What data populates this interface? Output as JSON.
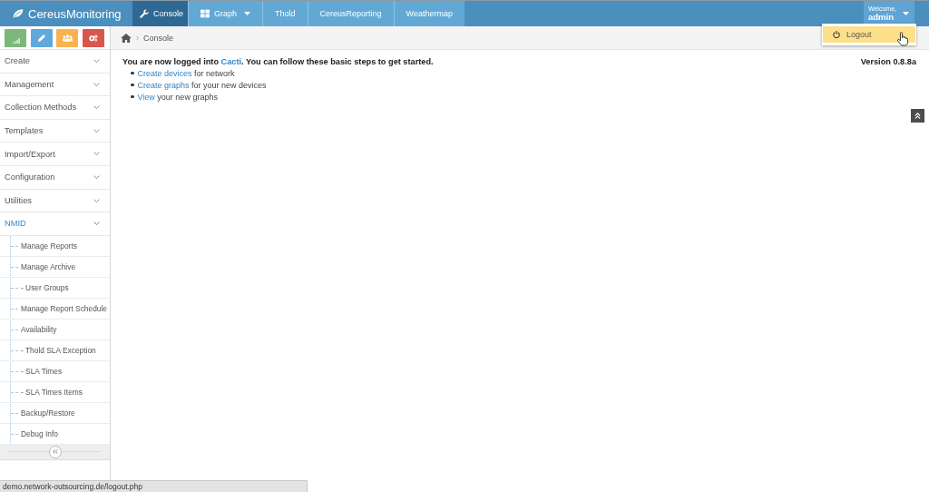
{
  "header": {
    "brand": "CereusMonitoring",
    "tabs": [
      {
        "label": "Console",
        "selected": true,
        "has_menu": false
      },
      {
        "label": "Graph",
        "selected": false,
        "has_menu": true
      },
      {
        "label": "Thold",
        "selected": false,
        "has_menu": false
      },
      {
        "label": "CereusReporting",
        "selected": false,
        "has_menu": false
      },
      {
        "label": "Weathermap",
        "selected": false,
        "has_menu": false
      }
    ],
    "user": {
      "greeting": "Welcome,",
      "name": "admin"
    }
  },
  "user_menu": {
    "items": [
      {
        "label": "Logout",
        "highlighted": true
      }
    ]
  },
  "sidebar": {
    "quick_buttons": [
      {
        "color": "#7cb77b"
      },
      {
        "color": "#61a9dc"
      },
      {
        "color": "#f9b24f"
      },
      {
        "color": "#d9574a"
      }
    ],
    "menu": [
      {
        "label": "Create",
        "expanded": false
      },
      {
        "label": "Management",
        "expanded": false
      },
      {
        "label": "Collection Methods",
        "expanded": false
      },
      {
        "label": "Templates",
        "expanded": false
      },
      {
        "label": "Import/Export",
        "expanded": false
      },
      {
        "label": "Configuration",
        "expanded": false
      },
      {
        "label": "Utilities",
        "expanded": false
      },
      {
        "label": "NMID",
        "expanded": true,
        "children": [
          {
            "label": "Manage Reports"
          },
          {
            "label": "Manage Archive"
          },
          {
            "label": "- User Groups"
          },
          {
            "label": "Manage Report Schedule"
          },
          {
            "label": "Availability"
          },
          {
            "label": "- Thold SLA Exception"
          },
          {
            "label": "- SLA Times"
          },
          {
            "label": "- SLA Times Items"
          },
          {
            "label": "Backup/Restore"
          },
          {
            "label": "Debug Info"
          }
        ]
      }
    ]
  },
  "breadcrumb": {
    "items": [
      "Console"
    ]
  },
  "content": {
    "intro": [
      {
        "kind": "text",
        "text": "You are now logged into "
      },
      {
        "kind": "link",
        "text": "Cacti"
      },
      {
        "kind": "text",
        "text": ". You can follow these basic steps to get started."
      }
    ],
    "version": "Version 0.8.8a",
    "steps": [
      {
        "parts": [
          {
            "kind": "link",
            "text": "Create devices"
          },
          {
            "kind": "text",
            "text": " for network"
          }
        ]
      },
      {
        "parts": [
          {
            "kind": "link",
            "text": "Create graphs"
          },
          {
            "kind": "text",
            "text": " for your new devices"
          }
        ]
      },
      {
        "parts": [
          {
            "kind": "link",
            "text": "View"
          },
          {
            "kind": "text",
            "text": " your new graphs"
          }
        ]
      }
    ]
  },
  "status_bar": {
    "text": "demo.network-outsourcing.de/logout.php"
  }
}
